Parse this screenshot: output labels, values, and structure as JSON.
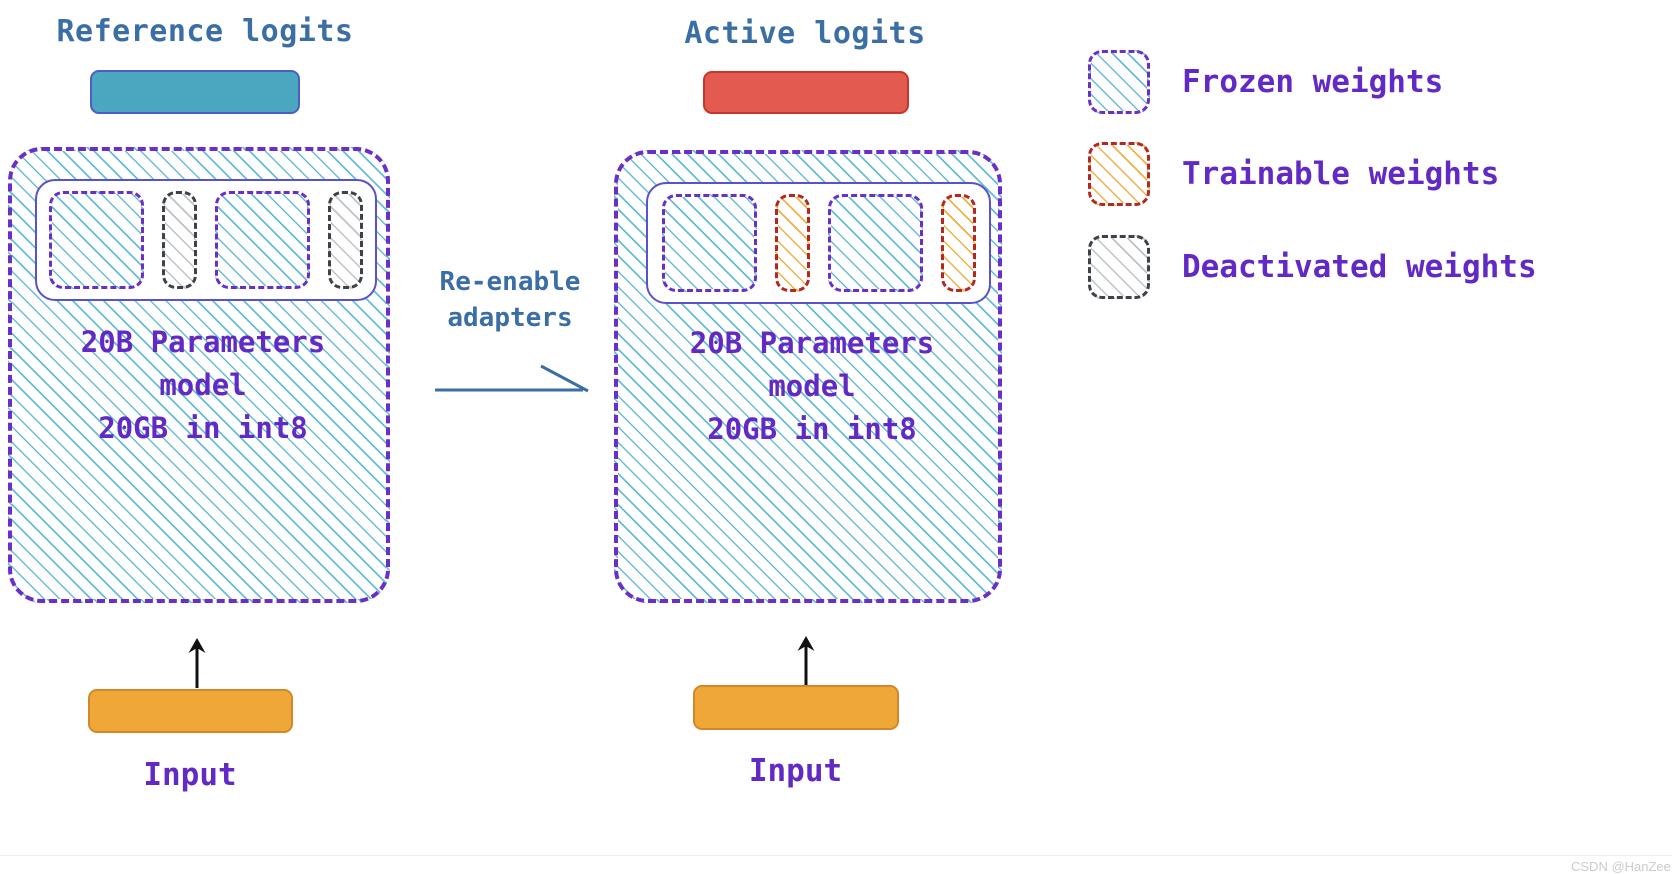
{
  "diagram": {
    "left_panel": {
      "logits_title": "Reference logits",
      "logits_bar_color": "#4ba6bf",
      "model_caption": "20B Parameters\nmodel\n20GB in int8",
      "blocks": [
        {
          "kind": "frozen",
          "size": "wide"
        },
        {
          "kind": "deactivated",
          "size": "narrow"
        },
        {
          "kind": "frozen",
          "size": "wide"
        },
        {
          "kind": "deactivated",
          "size": "narrow"
        }
      ],
      "input_label": "Input",
      "input_bar_color": "#efa838"
    },
    "right_panel": {
      "logits_title": "Active logits",
      "logits_bar_color": "#e25a50",
      "model_caption": "20B Parameters\nmodel\n20GB in int8",
      "blocks": [
        {
          "kind": "frozen",
          "size": "wide"
        },
        {
          "kind": "trainable",
          "size": "narrow"
        },
        {
          "kind": "frozen",
          "size": "wide"
        },
        {
          "kind": "trainable",
          "size": "narrow"
        }
      ],
      "input_label": "Input",
      "input_bar_color": "#efa838"
    },
    "transition": {
      "label": "Re-enable\nadapters",
      "arrow_color": "#3a6ea5"
    },
    "legend": {
      "items": [
        {
          "label": "Frozen weights",
          "kind": "frozen",
          "border_color": "#6b2fc9",
          "hatch_color": "#5dbad6"
        },
        {
          "label": "Trainable weights",
          "kind": "trainable",
          "border_color": "#b5281f",
          "hatch_color": "#f0ad3a"
        },
        {
          "label": "Deactivated weights",
          "kind": "deactivated",
          "border_color": "#3d4249",
          "hatch_color": "#afb2b6"
        }
      ]
    },
    "colors": {
      "purple_text": "#6229c4",
      "blue_text": "#3a6ea5",
      "frozen_border": "#6b2fc9",
      "trainable_border": "#b5281f",
      "deactivated_border": "#3d4249"
    }
  },
  "watermark": {
    "text": "CSDN @HanZee"
  }
}
